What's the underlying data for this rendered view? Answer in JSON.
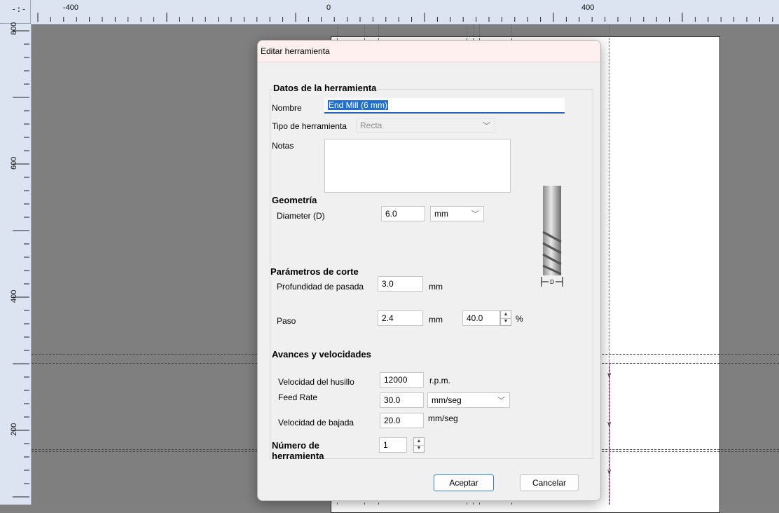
{
  "rulers": {
    "corner_glyph": "-:-",
    "horizontal_labels": [
      "-400",
      "0",
      "400"
    ],
    "vertical_labels": [
      "800",
      "600",
      "400",
      "200"
    ]
  },
  "dialog": {
    "title": "Editar herramienta",
    "datos": {
      "legend": "Datos de la herramienta",
      "nombre_label": "Nombre",
      "nombre_value": "End Mill (6 mm)",
      "tipo_label": "Tipo de herramienta",
      "tipo_value": "Recta",
      "notas_label": "Notas",
      "notas_value": ""
    },
    "geometria": {
      "legend": "Geometría",
      "diameter_label": "Diameter (D)",
      "diameter_value": "6.0",
      "unit_value": "mm"
    },
    "tool_image_label": "D",
    "corte": {
      "legend": "Parámetros de corte",
      "profundidad_label": "Profundidad de pasada",
      "profundidad_value": "3.0",
      "profundidad_unit": "mm",
      "paso_label": "Paso",
      "paso_value": "2.4",
      "paso_unit": "mm",
      "paso_percent_value": "40.0",
      "percent_sign": "%"
    },
    "avances": {
      "legend": "Avances y velocidades",
      "husillo_label": "Velocidad del husillo",
      "husillo_value": "12000",
      "husillo_unit": "r.p.m.",
      "feed_label": "Feed Rate",
      "feed_value": "30.0",
      "feed_unit": "mm/seg",
      "bajada_label": "Velocidad de bajada",
      "bajada_value": "20.0",
      "bajada_unit": "mm/seg"
    },
    "numero": {
      "label_line1": "Número de",
      "label_line2": "herramienta",
      "value": "1"
    },
    "buttons": {
      "accept": "Aceptar",
      "cancel": "Cancelar"
    }
  },
  "colors": {
    "accent": "#1f6fd0",
    "title_bg": "#fdf0ef",
    "canvas_bg": "#7f7f7f"
  }
}
